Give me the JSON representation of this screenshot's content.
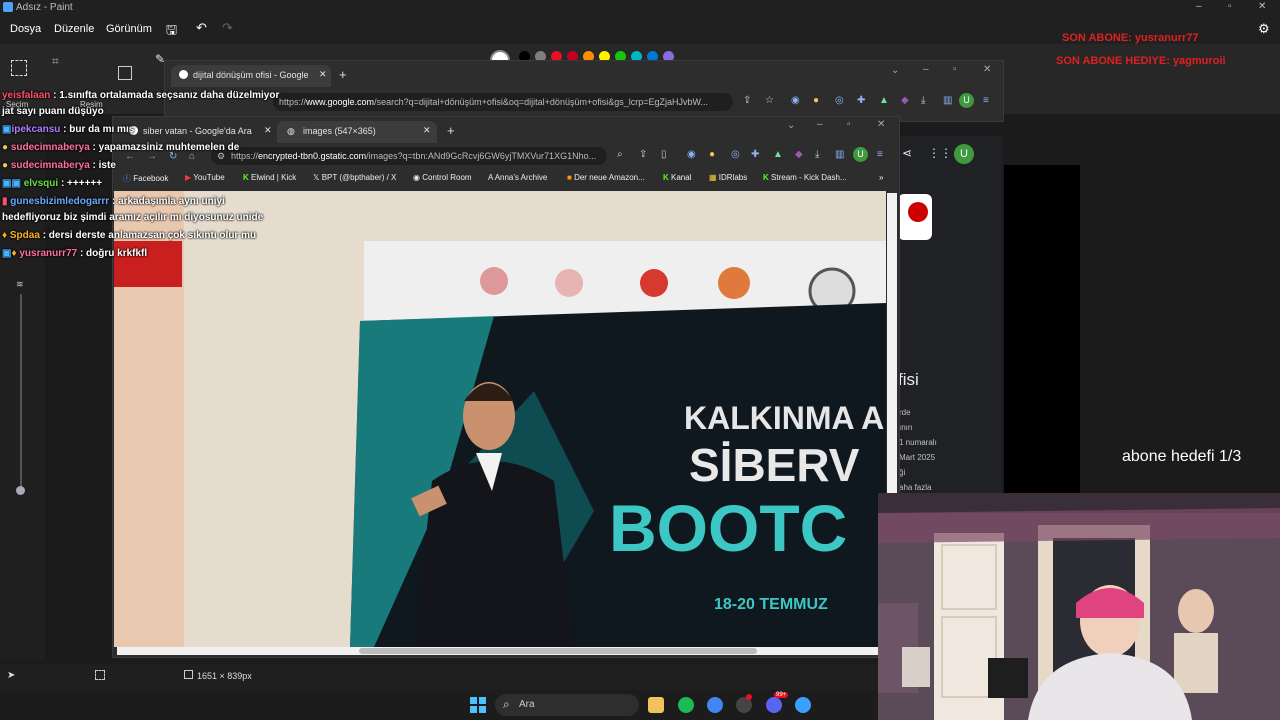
{
  "paint": {
    "title": "Adsız - Paint",
    "menus": [
      "Dosya",
      "Düzenle",
      "Görünüm"
    ],
    "tools_labels": {
      "selection": "Seçim",
      "image": "Resim"
    },
    "status_size": "1651 × 839px"
  },
  "palette": [
    "#ffffff",
    "#000000",
    "#7f7f7f",
    "#c0c0c0",
    "#e81123",
    "#ff8c00",
    "#fff100",
    "#16c60c",
    "#00b7c3",
    "#0078d4",
    "#886ce4",
    "#e3008c"
  ],
  "overlay": {
    "last_sub": "SON ABONE: yusranurr77",
    "last_gift": "SON ABONE HEDIYE: yagmuroii",
    "sub_goal": "abone hedefi 1/3"
  },
  "chrome1": {
    "tab_title": "dijital dönüşüm ofisi - Google'da",
    "new_tab": "+",
    "url_prefix": "https://",
    "url_host": "www.google.com",
    "url_path": "/search?q=dijital+dönüşüm+ofisi&oq=dijital+dönüşüm+ofisi&gs_lcrp=EgZjaHJvbW...",
    "profile": "U"
  },
  "chrome2": {
    "tab1_title": "siber vatan - Google'da Ara",
    "tab2_title": "images (547×365)",
    "new_tab": "+",
    "url_prefix": "https://",
    "url_host": "encrypted-tbn0.gstatic.com",
    "url_path": "/images?q=tbn:ANd9GcRcvj6GW6yjTMXVur71XG1Nho...",
    "profile": "U",
    "bookmarks": [
      "Facebook",
      "YouTube",
      "Elwind | Kick",
      "BPT (@bpthaber) / X",
      "Control Room",
      "Anna's Archive",
      "Der neue Amazon...",
      "Kanal",
      "IDRlabs",
      "Stream - Kick Dash..."
    ]
  },
  "google_snippet": {
    "heading_fragment": "fisi",
    "lines": [
      "rde",
      "ının",
      "1 numaralı",
      "Mart 2025",
      "ği",
      "aha fazla"
    ]
  },
  "image_text": {
    "banner1": "KALKINMA A",
    "banner2": "SİBERV",
    "banner3": "BOOTC",
    "banner4": "18-20 TEMMUZ"
  },
  "chat": [
    {
      "user": "yeisfalaan",
      "msg": ": 1.sınıfta ortalamada seçsanız daha düzelmiyor",
      "color": "#ff4d6d"
    },
    {
      "user": "",
      "msg": "jat sayı puanı düşüyo",
      "color": "#ffffff"
    },
    {
      "user": "ipekcansu",
      "msg": ": bur da mı mış",
      "color": "#b07cff"
    },
    {
      "user": "sudecimnaberya",
      "msg": ": yapamazsiniz muhtemelen de",
      "color": "#ff6fa0"
    },
    {
      "user": "sudecimnaberya",
      "msg": ": iste",
      "color": "#ff6fa0"
    },
    {
      "user": "elvsqui",
      "msg": ": ++++++",
      "color": "#6cdc4a"
    },
    {
      "user": "gunesbizimledogarrr",
      "msg": ": arkadaşımla aynı uniyi",
      "color": "#6aa8ff"
    },
    {
      "user": "",
      "msg": "hedefliyoruz biz şimdi aramız açılır mı diyosunuz unide",
      "color": "#ffffff"
    },
    {
      "user": "Spdaa",
      "msg": ": dersi derste anlamazsan çok sıkıntı olur mu",
      "color": "#ffb020"
    },
    {
      "user": "yusranurr77",
      "msg": ": doğru krkfkfl",
      "color": "#ff6fa0"
    }
  ],
  "taskbar": {
    "search_placeholder": "Ara",
    "notification_count": "99+"
  }
}
